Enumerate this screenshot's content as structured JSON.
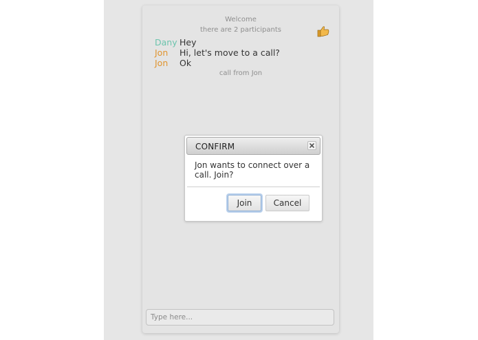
{
  "colors": {
    "dany": "#6cc4ad",
    "jon": "#e0942f",
    "system_text": "#8e8e8e",
    "focus_ring": "#b9d0ec"
  },
  "chat": {
    "welcome": "Welcome",
    "participants_notice": "there are 2 participants",
    "reaction_icon": "thumbs-up-icon",
    "messages": [
      {
        "sender": "Dany",
        "text": "Hey",
        "color": "#6cc4ad"
      },
      {
        "sender": "Jon",
        "text": "Hi, let's move to a call?",
        "color": "#e0942f"
      },
      {
        "sender": "Jon",
        "text": "Ok",
        "color": "#e0942f"
      }
    ],
    "call_notice": "call from Jon",
    "input_placeholder": "Type here..."
  },
  "dialog": {
    "title": "CONFIRM",
    "close_icon": "close-icon",
    "message": "Jon wants to connect over a call. Join?",
    "join_label": "Join",
    "cancel_label": "Cancel"
  }
}
